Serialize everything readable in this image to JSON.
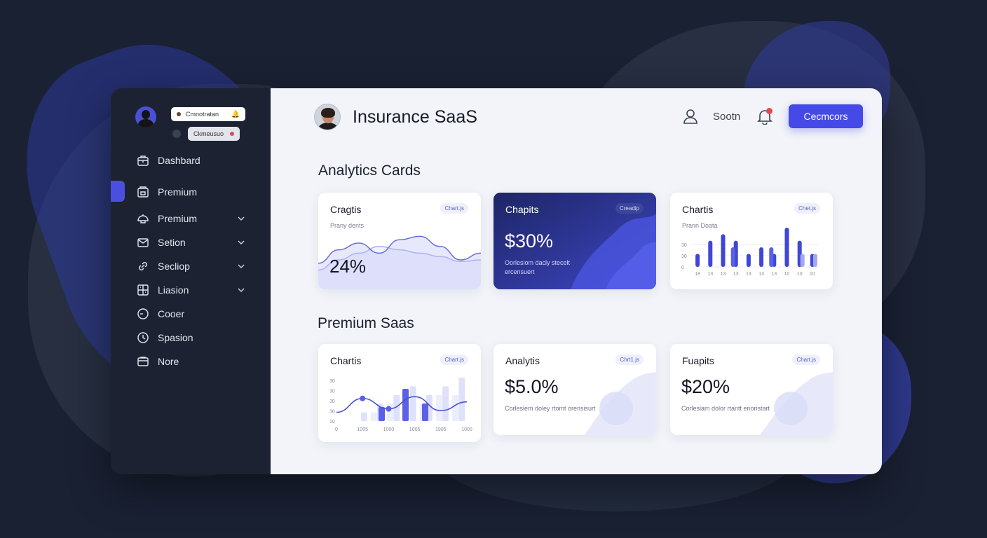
{
  "sidebar": {
    "notification_1": "Cmnotratan",
    "notification_2": "Ckmeusuo",
    "items": [
      {
        "label": "Dashbard",
        "icon": "briefcase-icon",
        "chevron": false
      },
      {
        "label": "Premium",
        "icon": "wallet-icon",
        "chevron": false,
        "active": true
      },
      {
        "label": "Premium",
        "icon": "umbrella-icon",
        "chevron": true
      },
      {
        "label": "Setion",
        "icon": "mail-icon",
        "chevron": true
      },
      {
        "label": "Secliop",
        "icon": "link-icon",
        "chevron": true
      },
      {
        "label": "Liasion",
        "icon": "grid-icon",
        "chevron": true
      },
      {
        "label": "Cooer",
        "icon": "clock-icon",
        "chevron": false
      },
      {
        "label": "Spasion",
        "icon": "time-icon",
        "chevron": false
      },
      {
        "label": "Nore",
        "icon": "folder-icon",
        "chevron": false
      }
    ]
  },
  "header": {
    "title": "Insurance SaaS",
    "user_label": "Sootn",
    "cta_label": "Cecmcors"
  },
  "sections": {
    "analytics_title": "Analytics Cards",
    "premium_title": "Premium Saas"
  },
  "cards": {
    "card1": {
      "title": "Cragtis",
      "badge": "Chart.js",
      "subtitle": "Prany dents",
      "value": "24%"
    },
    "card2": {
      "title": "Chapits",
      "badge": "Creadip",
      "value": "$30%",
      "desc": "Oorlesiom dacly stecelt ercensuert"
    },
    "card3": {
      "title": "Chartis",
      "badge": "Chet.js",
      "subtitle": "Prann Doata"
    },
    "card4": {
      "title": "Chartis",
      "badge": "Chart.js"
    },
    "card5": {
      "title": "Analytis",
      "badge": "Chrt1.js",
      "value": "$5.0%",
      "desc": "Corlesiem doley rtomt orensisurt"
    },
    "card6": {
      "title": "Fuapits",
      "badge": "Chart.js",
      "value": "$20%",
      "desc": "Corlesiam dolor rtantt enoristart"
    }
  },
  "chart_data": [
    {
      "type": "area",
      "title": "Cragtis",
      "x": [
        0,
        1,
        2,
        3,
        4,
        5,
        6,
        7,
        8
      ],
      "series": [
        {
          "values": [
            8,
            16,
            20,
            14,
            22,
            24,
            18,
            10,
            14
          ]
        },
        {
          "values": [
            4,
            10,
            14,
            18,
            16,
            14,
            12,
            9,
            10
          ]
        }
      ],
      "ylim": [
        0,
        30
      ]
    },
    {
      "type": "bar",
      "title": "Chartis",
      "categories": [
        "18",
        "13",
        "13",
        "13",
        "13",
        "13",
        "13",
        "10",
        "10",
        "10"
      ],
      "y_ticks": [
        "0",
        "30",
        "30"
      ],
      "series": [
        {
          "values": [
            2,
            4,
            5,
            4,
            2,
            3,
            2,
            6,
            4,
            2
          ]
        },
        {
          "values": [
            0,
            0,
            0,
            3,
            0,
            0,
            3,
            0,
            0,
            0
          ]
        },
        {
          "values": [
            0,
            0,
            0,
            0,
            0,
            0,
            0,
            0,
            2,
            2
          ]
        }
      ],
      "ylim": [
        0,
        6
      ]
    },
    {
      "type": "bar",
      "title": "Chartis",
      "categories": [
        "0",
        "1005",
        "1000",
        "1005",
        "1905",
        "1000"
      ],
      "y_ticks": [
        "10",
        "30",
        "30",
        "30",
        "30"
      ],
      "series": [
        {
          "values": [
            0,
            1,
            2,
            3,
            4,
            3,
            4,
            5
          ]
        },
        {
          "values": [
            0,
            0,
            1,
            2,
            2,
            2,
            3,
            3
          ]
        }
      ],
      "line": [
        1,
        2.6,
        1.4,
        2.8,
        1.2,
        2.2
      ],
      "ylim": [
        0,
        5
      ]
    }
  ]
}
